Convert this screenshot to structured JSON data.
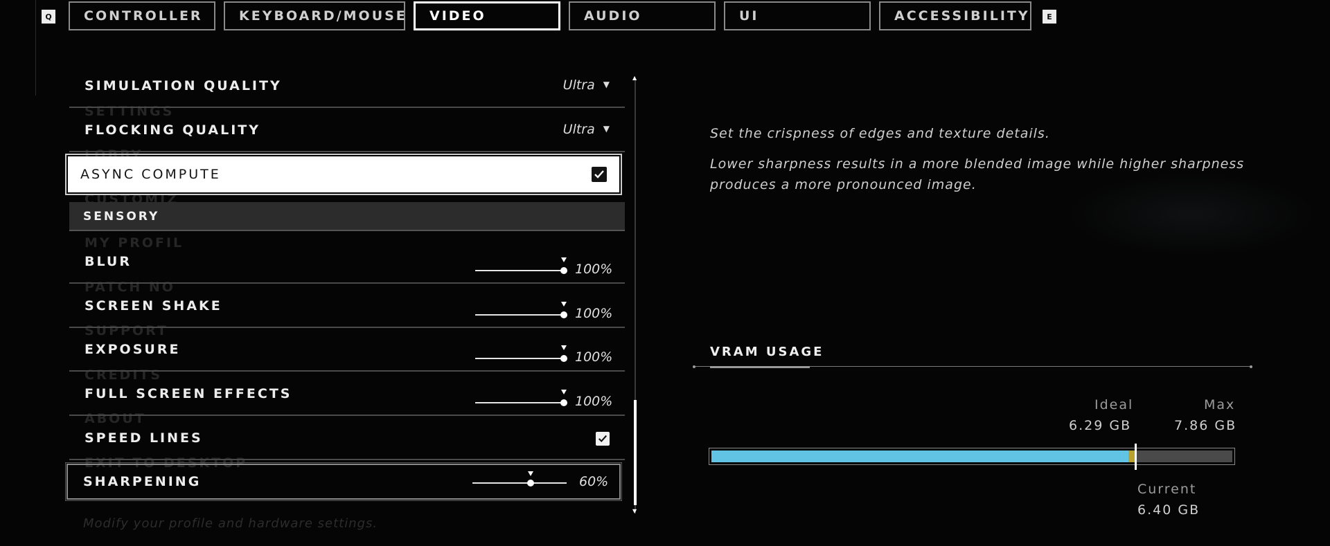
{
  "tabs": {
    "left_key": "Q",
    "right_key": "E",
    "items": [
      {
        "label": "CONTROLLER"
      },
      {
        "label": "KEYBOARD/MOUSE"
      },
      {
        "label": "VIDEO"
      },
      {
        "label": "AUDIO"
      },
      {
        "label": "UI"
      },
      {
        "label": "ACCESSIBILITY"
      }
    ],
    "active": "VIDEO"
  },
  "background_menu": {
    "items": [
      "SETTINGS",
      "LOBBY",
      "CUSTOMIZ",
      "MY PROFIL",
      "PATCH NO",
      "SUPPORT",
      "CREDITS",
      "ABOUT",
      "EXIT TO DESKTOP"
    ],
    "footer": "Modify your profile and hardware settings."
  },
  "settings": {
    "simulation_quality": {
      "label": "SIMULATION QUALITY",
      "value": "Ultra"
    },
    "flocking_quality": {
      "label": "FLOCKING QUALITY",
      "value": "Ultra"
    },
    "async_compute": {
      "label": "ASYNC COMPUTE",
      "checked": true
    },
    "section_sensory": "SENSORY",
    "blur": {
      "label": "BLUR",
      "value": "100%",
      "level": 1.0
    },
    "screen_shake": {
      "label": "SCREEN SHAKE",
      "value": "100%",
      "level": 1.0
    },
    "exposure": {
      "label": "EXPOSURE",
      "value": "100%",
      "level": 1.0
    },
    "full_screen_effects": {
      "label": "FULL SCREEN EFFECTS",
      "value": "100%",
      "level": 1.0
    },
    "speed_lines": {
      "label": "SPEED LINES",
      "checked": true
    },
    "sharpening": {
      "label": "SHARPENING",
      "value": "60%",
      "level": 0.6
    }
  },
  "description": {
    "line1": "Set the crispness of edges and texture details.",
    "line2a": "Lower sharpness results in a more blended image while higher sharpness",
    "line2b": "produces a more pronounced image."
  },
  "vram": {
    "title": "VRAM USAGE",
    "ideal_label": "Ideal",
    "ideal_value": "6.29 GB",
    "max_label": "Max",
    "max_value": "7.86 GB",
    "current_label": "Current",
    "current_value": "6.40 GB",
    "ideal_gb": 6.29,
    "current_gb": 6.4,
    "max_gb": 7.86,
    "colors": {
      "usage": "#62c4e5",
      "over_ideal": "#b9a232",
      "remaining": "#4a4a4a"
    }
  }
}
